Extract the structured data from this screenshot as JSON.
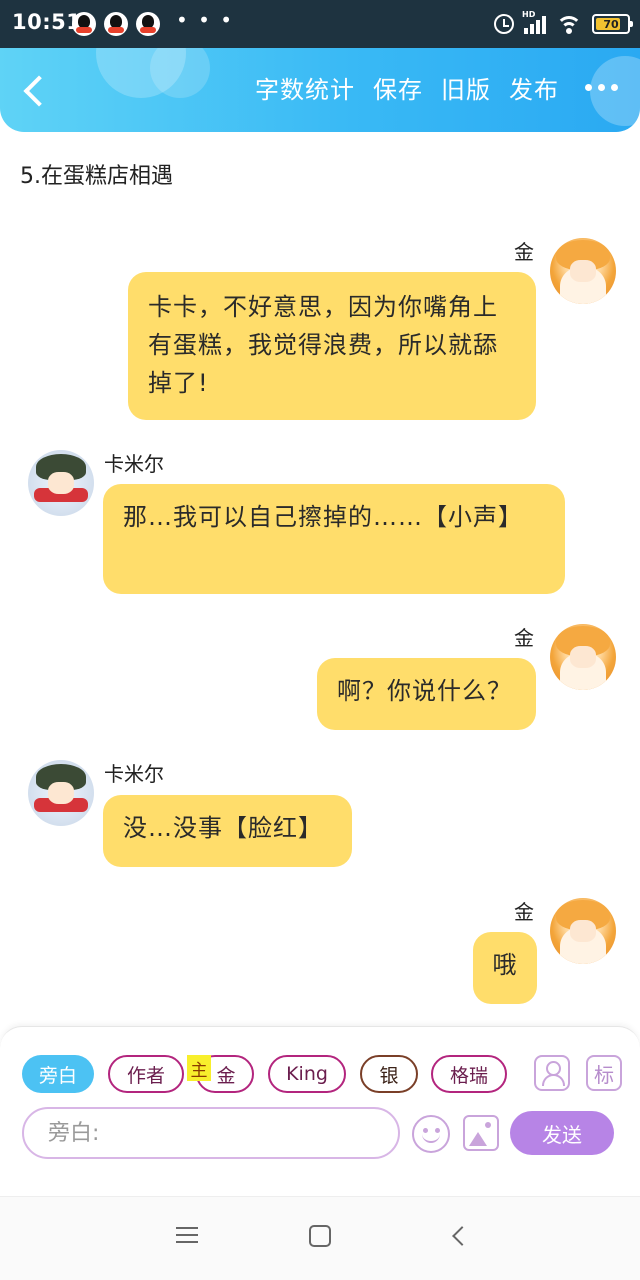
{
  "status_bar": {
    "time": "10:51",
    "dots": "• • •",
    "battery": "70",
    "network": "HD"
  },
  "header": {
    "actions": [
      {
        "label": "字数统计"
      },
      {
        "label": "保存"
      },
      {
        "label": "旧版"
      },
      {
        "label": "发布"
      }
    ]
  },
  "story": {
    "title": "5.在蛋糕店相遇"
  },
  "messages": [
    {
      "sender": "金",
      "side": "right",
      "text": "卡卡，不好意思，因为你嘴角上有蛋糕，我觉得浪费，所以就舔掉了!"
    },
    {
      "sender": "卡米尔",
      "side": "left",
      "text": "那…我可以自己擦掉的……【小声】"
    },
    {
      "sender": "金",
      "side": "right",
      "text": "啊？你说什么？"
    },
    {
      "sender": "卡米尔",
      "side": "left",
      "text": "没…没事【脸红】"
    },
    {
      "sender": "金",
      "side": "right",
      "text": "哦"
    }
  ],
  "roles": [
    {
      "label": "旁白",
      "active": true
    },
    {
      "label": "作者"
    },
    {
      "label": "金",
      "tag": "主"
    },
    {
      "label": "King"
    },
    {
      "label": "银"
    },
    {
      "label": "格瑞"
    }
  ],
  "tools": {
    "tag_label": "标"
  },
  "composer": {
    "placeholder": "旁白:",
    "send_label": "发送"
  },
  "colors": {
    "header_start": "#5fd3f6",
    "header_end": "#2aa9f2",
    "bubble": "#ffdd6b",
    "send": "#b784e6",
    "chip_active": "#4cc2f3",
    "chip_border": "#b3257e"
  }
}
